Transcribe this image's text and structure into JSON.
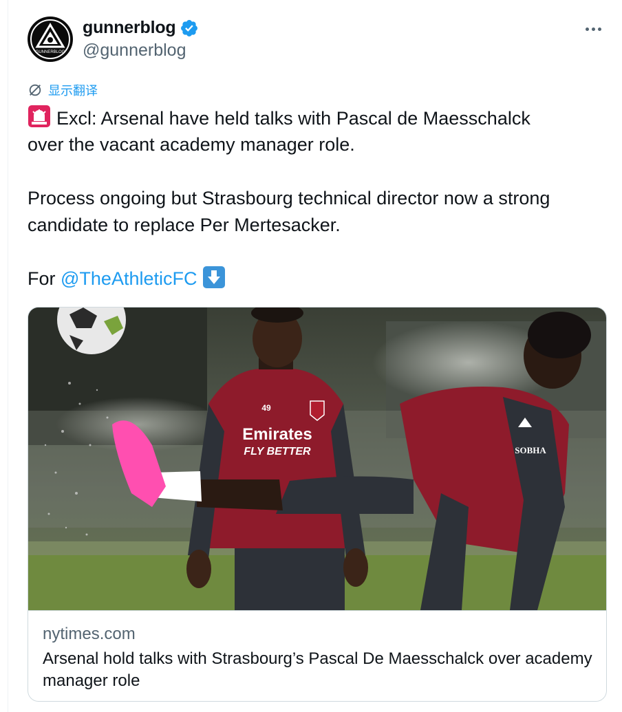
{
  "author": {
    "display_name": "gunnerblog",
    "handle": "@gunnerblog",
    "verified": true,
    "avatar_text": "GUNNERBLOG"
  },
  "translate": {
    "label": "显示翻译"
  },
  "tweet": {
    "line1": "Excl: Arsenal have held talks with Pascal de Maesschalck",
    "line2": "over the vacant academy manager role.",
    "line3": "Process ongoing but Strasbourg technical director now a strong",
    "line4": "candidate to replace Per Mertesacker.",
    "for_prefix": "For ",
    "mention": "@TheAthleticFC"
  },
  "link_card": {
    "domain": "nytimes.com",
    "title": "Arsenal hold talks with Strasbourg’s Pascal De Maesschalck over academy manager role",
    "image_shirt_sponsor_1": "Emirates",
    "image_shirt_sponsor_2": "FLY BETTER",
    "image_sleeve_sponsor": "SOBHA",
    "image_shirt_number": "49"
  },
  "colors": {
    "accent": "#1d9bf0",
    "text_primary": "#0f1419",
    "text_secondary": "#536471",
    "border": "#cfd9de",
    "kit_red": "#8e1b2b",
    "boot_pink": "#ff4fb0"
  },
  "icons": {
    "more": "more-dots-icon",
    "verified": "verified-badge-icon",
    "translate": "translate-globe-icon",
    "siren": "police-light-emoji",
    "down_arrow": "down-arrow-emoji"
  }
}
